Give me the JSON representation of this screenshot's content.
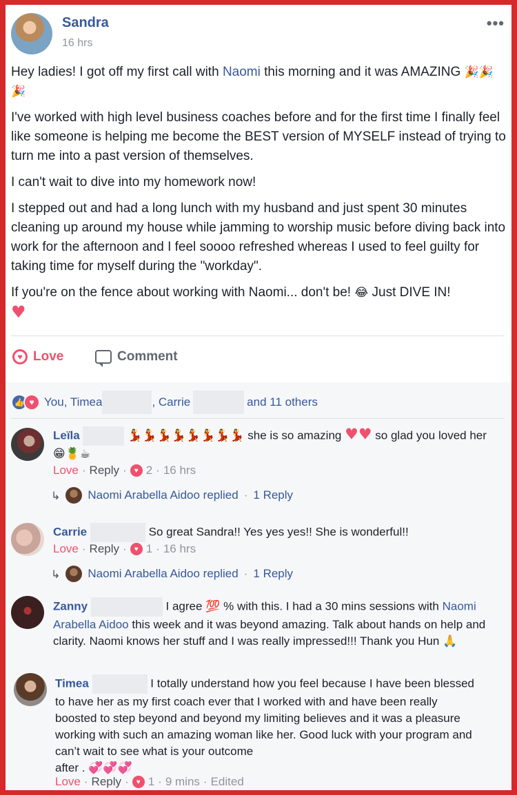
{
  "post": {
    "author": "Sandra",
    "time": "16 hrs",
    "more": "•••",
    "p1_a": "Hey ladies! I got off my first call with ",
    "p1_link": "Naomi",
    "p1_b": " this morning and it was AMAZING ",
    "p1_emoji": "🎉🎉🎉",
    "p2": "I've worked with high level business coaches before and for the first time I finally feel like someone is helping me become the BEST version of MYSELF instead of trying to turn me into a past version of themselves.",
    "p3": "I can't wait to dive into my homework now!",
    "p4": "I stepped out and had a long lunch with my husband and just spent 30 minutes cleaning up around my house while jamming to worship music before diving back into work for the afternoon and I feel soooo refreshed whereas I used to feel guilty for taking time for myself during the \"workday\".",
    "p5": "If you're on the fence about working with Naomi... don't be! ",
    "p5_emoji": "😂",
    "p5_b": " Just DIVE IN!",
    "p5_heart": "♥"
  },
  "actions": {
    "love_label": "Love",
    "comment_label": "Comment"
  },
  "reactions": {
    "you_timea": "You, Timea",
    "carrie": ", Carrie",
    "others": "and 11 others"
  },
  "comments": [
    {
      "name": "Leïla",
      "emoji": "💃💃💃💃💃💃💃💃",
      "text": "she is so amazing",
      "hearts": "♥♥",
      "text2": "so glad you loved her",
      "emoji2": "😁🍍☕",
      "love": "Love",
      "reply": "Reply",
      "count": "2",
      "time": "16 hrs",
      "replied": "Naomi Arabella Aidoo replied",
      "replies": "1 Reply"
    },
    {
      "name": "Carrie",
      "text": "So great Sandra!! Yes yes yes!! She is wonderful!!",
      "love": "Love",
      "reply": "Reply",
      "count": "1",
      "time": "16 hrs",
      "replied": "Naomi Arabella Aidoo replied",
      "replies": "1 Reply"
    },
    {
      "name": "Zanny",
      "text_a": "I agree",
      "emoji": "💯",
      "text_b": "% with this. I had a 30 mins sessions with",
      "link": "Naomi Arabella Aidoo",
      "text_c": "this week and it was beyond amazing. Talk about hands on help and clarity. Naomi knows her stuff and I was really impressed!!! Thank you Hun",
      "emoji2": "🙏"
    },
    {
      "name": "Timea",
      "text": "I totally understand how you feel because I have been blessed to have her as my first coach ever that I worked with and have been really boosted to step beyond and beyond my limiting believes and it was a pleasure working with such an amazing woman like her. Good luck with your program and can’t wait to see what is your outcome",
      "after": "after .",
      "hearts": "💞💞💞",
      "love": "Love",
      "reply": "Reply",
      "count": "1",
      "time": "9 mins",
      "edited": "Edited"
    }
  ],
  "separator_dot": "·"
}
